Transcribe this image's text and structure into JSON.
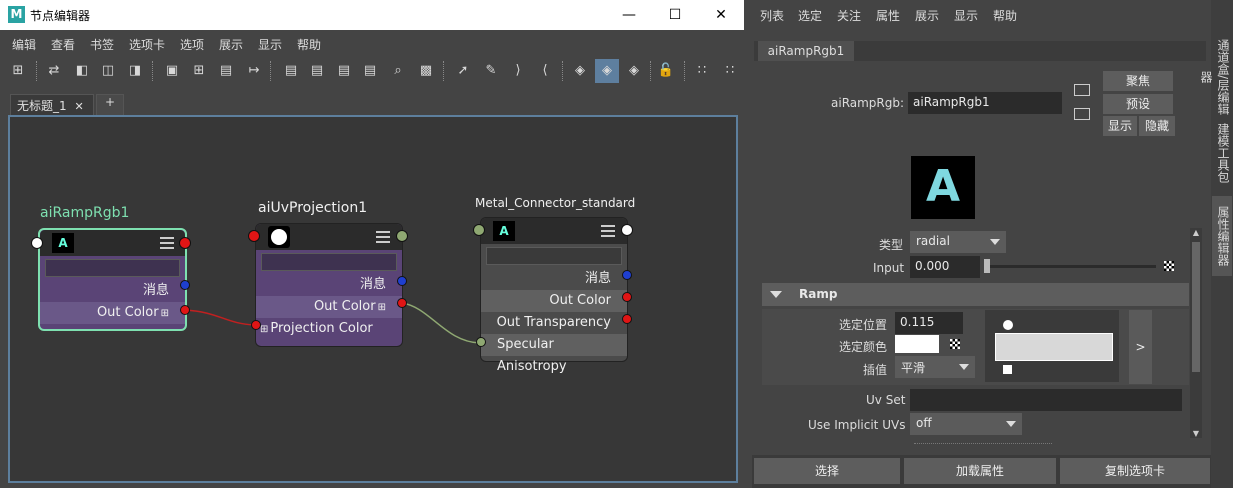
{
  "node_editor": {
    "window_title": "节点编辑器",
    "menu": [
      "编辑",
      "查看",
      "书签",
      "选项卡",
      "选项",
      "展示",
      "显示",
      "帮助"
    ],
    "tab_label": "无标题_1",
    "tab_close": "✕",
    "tab_add": "+",
    "nodes": {
      "ramp": {
        "title": "aiRampRgb1",
        "msg_label": "消息",
        "out_label": "Out Color"
      },
      "uv": {
        "title": "aiUvProjection1",
        "msg_label": "消息",
        "out_label": "Out Color",
        "in_label": "Projection Color"
      },
      "metal": {
        "title": "Metal_Connector_standard",
        "msg_label": "消息",
        "out_color": "Out Color",
        "out_transparency": "Out Transparency",
        "in_label": "Specular Anisotropy"
      }
    }
  },
  "attr_editor": {
    "menu": [
      "列表",
      "选定",
      "关注",
      "属性",
      "展示",
      "显示",
      "帮助"
    ],
    "tab_label": "aiRampRgb1",
    "name_label": "aiRampRgb:",
    "name_value": "aiRampRgb1",
    "buttons": {
      "focus": "聚焦",
      "presets": "预设",
      "show": "显示",
      "hide": "隐藏"
    },
    "type_label": "类型",
    "type_value": "radial",
    "input_label": "Input",
    "input_value": "0.000",
    "ramp_section": "Ramp",
    "sel_pos_label": "选定位置",
    "sel_pos_value": "0.115",
    "sel_color_label": "选定颜色",
    "interp_label": "插值",
    "interp_value": "平滑",
    "expand_button": ">",
    "uvset_label": "Uv Set",
    "uvset_value": "",
    "implicit_label": "Use Implicit UVs",
    "implicit_value": "off",
    "bottom_buttons": [
      "选择",
      "加载属性",
      "复制选项卡"
    ],
    "side_tabs": [
      "通道盒/层编辑器",
      "建模工具包",
      "属性编辑器"
    ]
  },
  "colors": {
    "accent_green": "#7ee0b0",
    "port_red": "#e01515",
    "port_blue": "#1f3fcf",
    "port_green": "#8fa872",
    "node_purple": "#5a4476"
  }
}
